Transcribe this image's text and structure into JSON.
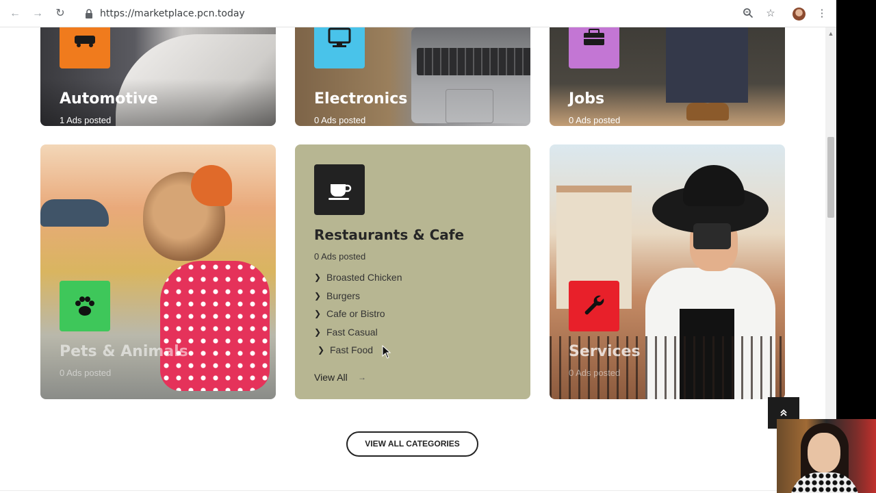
{
  "browser": {
    "url": "https://marketplace.pcn.today"
  },
  "categories_top": [
    {
      "title": "Automotive",
      "count": "1  Ads posted",
      "icon": "car-icon",
      "color": "#f07b1d"
    },
    {
      "title": "Electronics",
      "count": "0  Ads posted",
      "icon": "monitor-icon",
      "color": "#49c3ea"
    },
    {
      "title": "Jobs",
      "count": "0  Ads posted",
      "icon": "briefcase-icon",
      "color": "#c376d4"
    }
  ],
  "pets": {
    "title": "Pets & Animals",
    "count": "0  Ads posted",
    "icon": "paw-icon",
    "color": "#3ec75a"
  },
  "restaurants": {
    "title": "Restaurants & Cafe",
    "count": "0  Ads posted",
    "icon": "coffee-cup-icon",
    "color": "#222222",
    "subcategories": [
      "Broasted Chicken",
      "Burgers",
      "Cafe or Bistro",
      "Fast Casual",
      "Fast Food"
    ],
    "view_all": "View All"
  },
  "services": {
    "title": "Services",
    "count": "0  Ads posted",
    "icon": "wrench-icon",
    "color": "#e8202a"
  },
  "view_all_categories": "VIEW ALL CATEGORIES",
  "colors": {
    "restaurant_card": "#b7b692"
  }
}
